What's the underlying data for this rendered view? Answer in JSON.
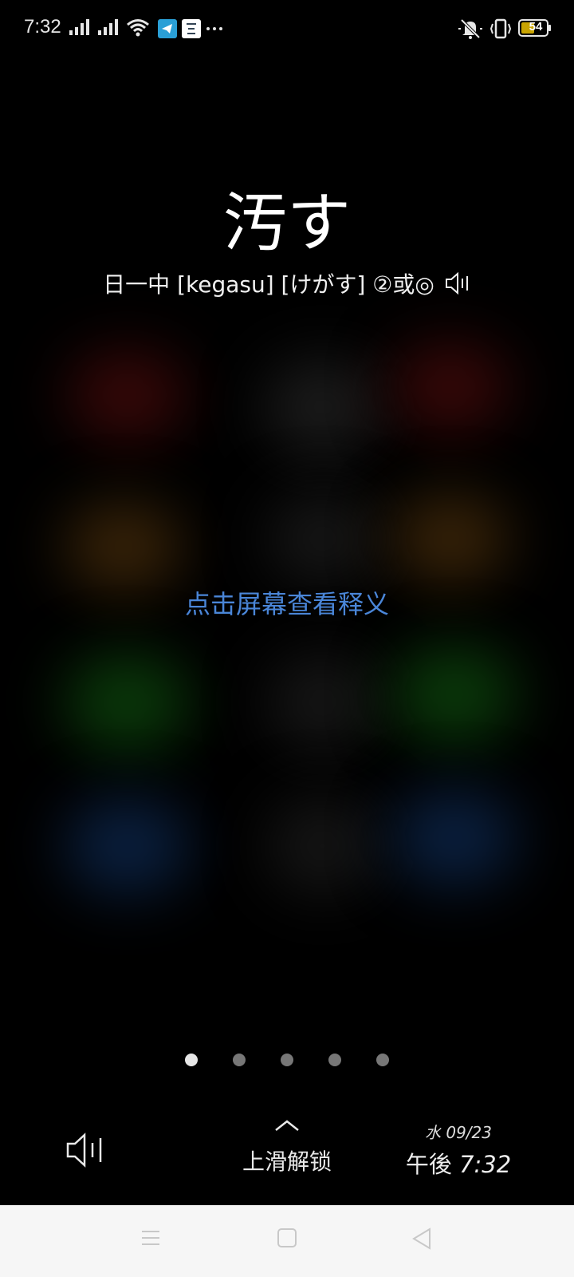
{
  "status_bar": {
    "time": "7:32",
    "battery": "54",
    "icons": [
      "signal-icon",
      "signal-icon",
      "wifi-icon",
      "telegram-icon",
      "app-notification-icon",
      "more-icon",
      "mute-bell-icon",
      "vibrate-icon",
      "battery-icon"
    ]
  },
  "word": {
    "headword": "汚す",
    "pronunciation": "日一中 [kegasu] [けがす] ②或◎"
  },
  "hint": "点击屏幕查看释义",
  "page_indicator": {
    "count": 5,
    "active": 0
  },
  "unlock": {
    "label": "上滑解锁"
  },
  "datetime": {
    "date": "水 09/23",
    "ampm": "午後",
    "time": "7:32"
  },
  "colors": {
    "hint": "#4a86d8",
    "background": "#000000",
    "navbar": "#f6f6f6"
  }
}
